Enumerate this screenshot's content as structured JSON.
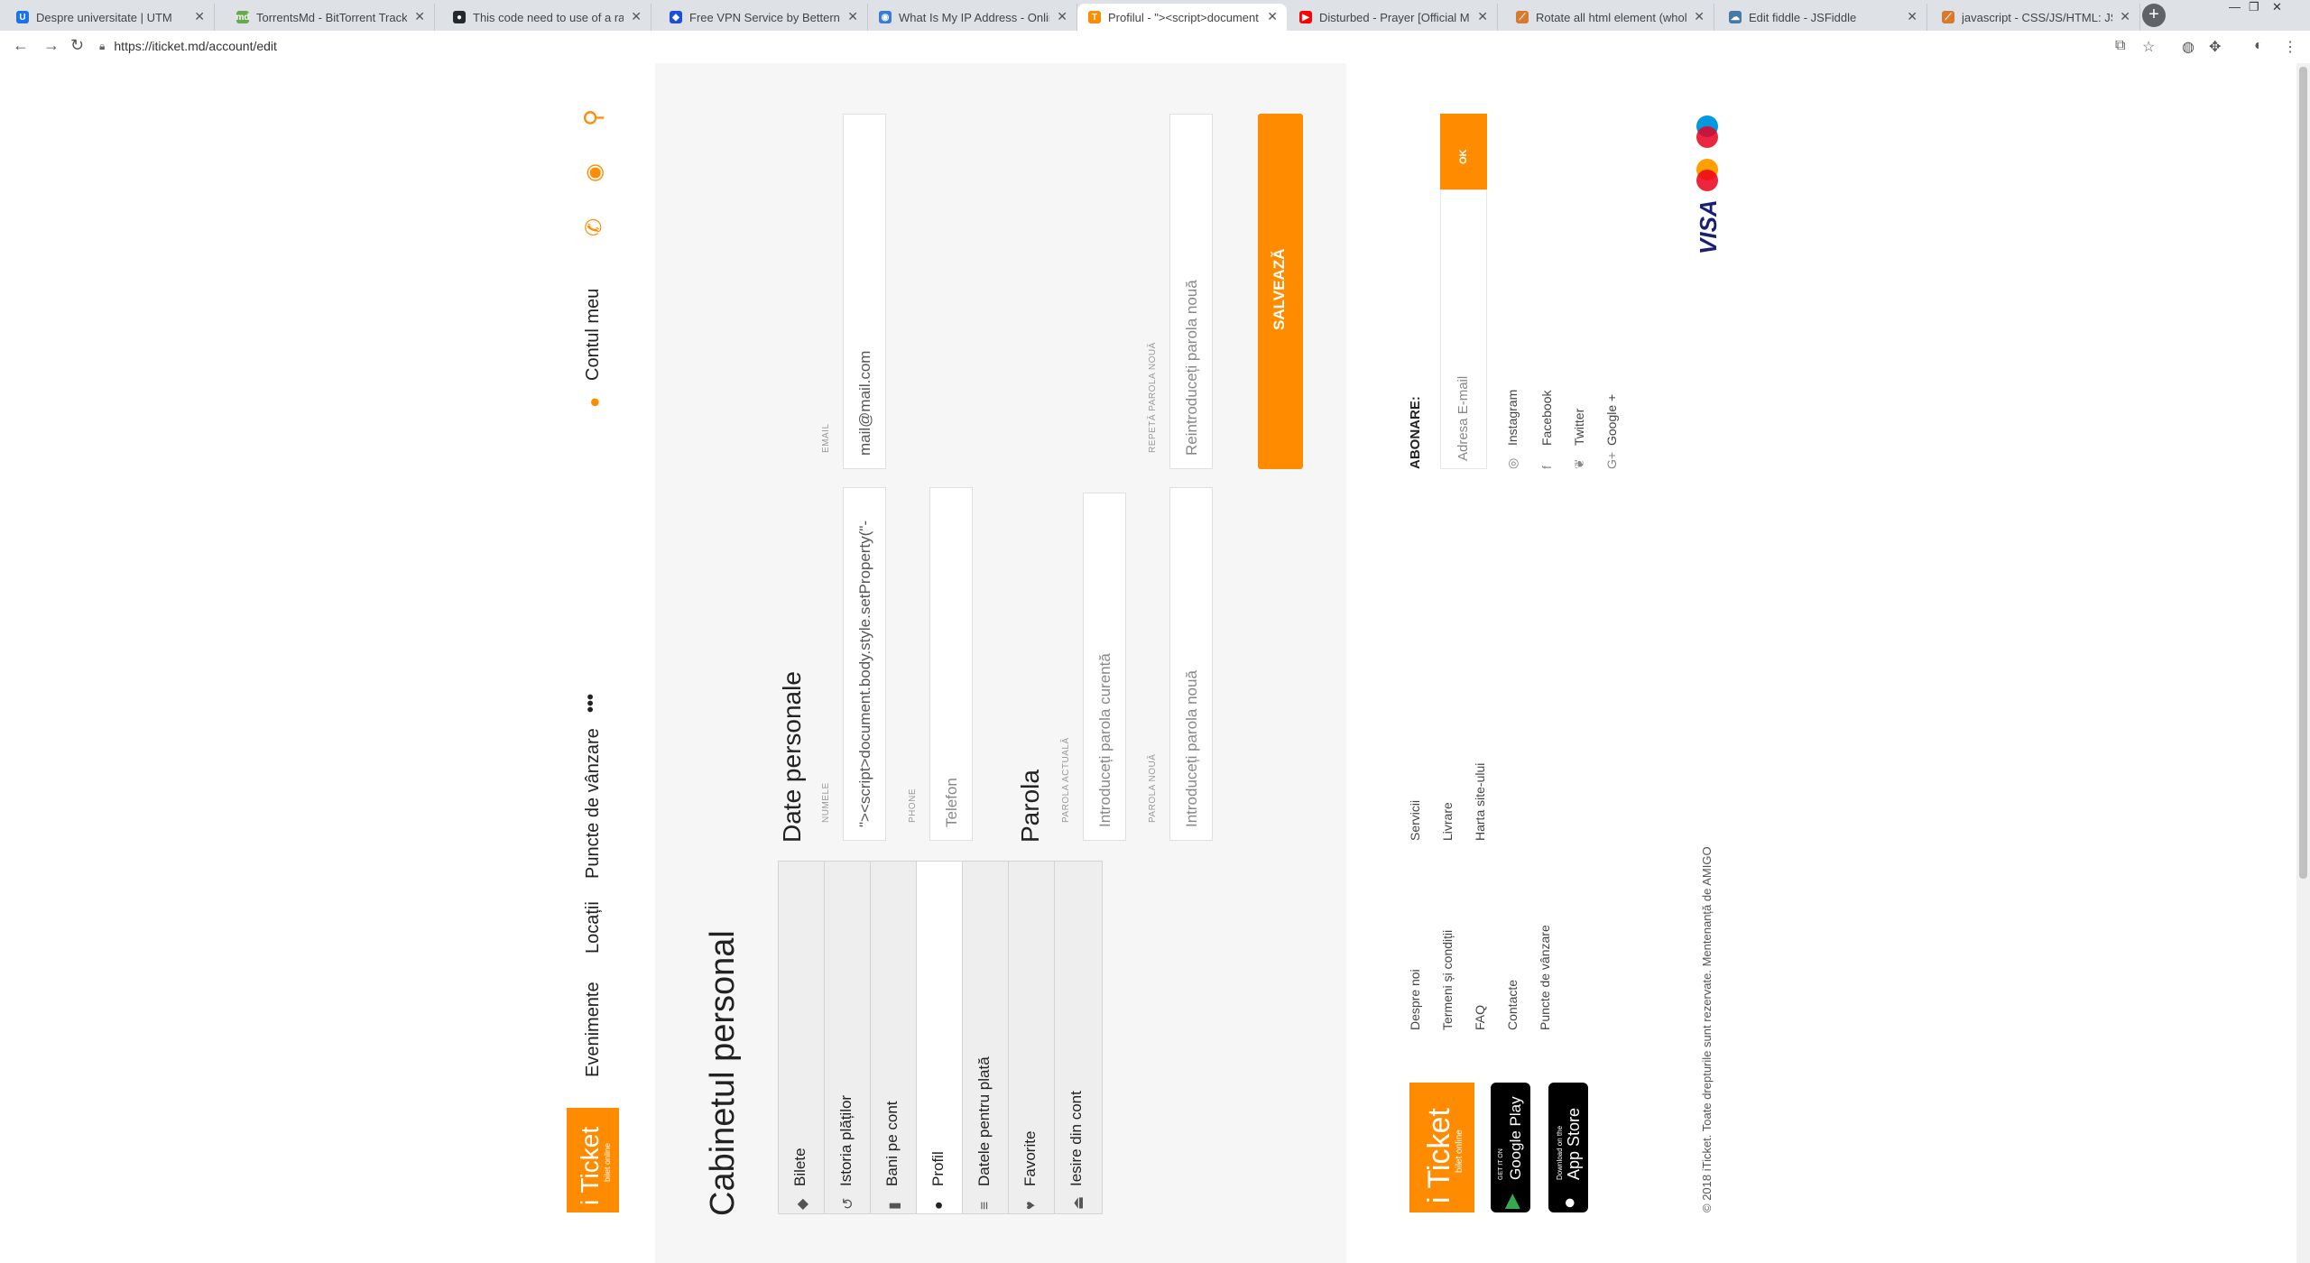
{
  "browser": {
    "tabs": [
      {
        "title": "Despre universitate | UTM",
        "fav_color": "#1a73e8",
        "fav_glyph": "U"
      },
      {
        "title": "TorrentsMd - BitTorrent Tracker",
        "fav_color": "#6aa84f",
        "fav_glyph": "md"
      },
      {
        "title": "This code need to use of a rando",
        "fav_color": "#24292e",
        "fav_glyph": "●"
      },
      {
        "title": "Free VPN Service by Betternet |",
        "fav_color": "#1e4fd8",
        "fav_glyph": "◆"
      },
      {
        "title": "What Is My IP Address - Online",
        "fav_color": "#3a7bd5",
        "fav_glyph": "◉"
      },
      {
        "title": "Profilul - \"><script>document.b",
        "fav_color": "#ff8c00",
        "fav_glyph": "T"
      },
      {
        "title": "Disturbed - Prayer [Official M",
        "fav_color": "#ff0000",
        "fav_glyph": "▶"
      },
      {
        "title": "Rotate all html element (whole p",
        "fav_color": "#d87a2c",
        "fav_glyph": "⟋"
      },
      {
        "title": "Edit fiddle - JSFiddle",
        "fav_color": "#4679a4",
        "fav_glyph": "☁"
      },
      {
        "title": "javascript - CSS/JS/HTML: JS Fun",
        "fav_color": "#d87a2c",
        "fav_glyph": "⟋"
      }
    ],
    "url": "https://iticket.md/account/edit"
  },
  "nav": {
    "logo_main": "i Ticket",
    "logo_sub": "bilet online",
    "links": [
      "Evenimente",
      "Locații",
      "Puncte de vânzare"
    ],
    "more": "•••",
    "account": "Contul meu"
  },
  "main": {
    "page_title": "Cabinetul personal",
    "menu": [
      {
        "label": "Bilete",
        "icon": "ticket-icon",
        "glyph": "◆"
      },
      {
        "label": "Istoria plăților",
        "icon": "history-icon",
        "glyph": "↺"
      },
      {
        "label": "Bani pe cont",
        "icon": "wallet-icon",
        "glyph": "▮"
      },
      {
        "label": "Profil",
        "icon": "user-icon",
        "glyph": "●"
      },
      {
        "label": "Datele pentru plată",
        "icon": "card-icon",
        "glyph": "≡"
      },
      {
        "label": "Favorite",
        "icon": "heart-icon",
        "glyph": "♥"
      },
      {
        "label": "Iesire din cont",
        "icon": "logout-icon",
        "glyph": "⏏"
      }
    ],
    "personal_title": "Date personale",
    "name_label": "NUMELE",
    "name_value": "\"><script>document.body.style.setProperty(\"-",
    "email_label": "EMAIL",
    "email_value": "mail@mail.com",
    "phone_label": "PHONE",
    "phone_placeholder": "Telefon",
    "password_title": "Parola",
    "current_pw_label": "PAROLA ACTUALĂ",
    "current_pw_placeholder": "Introduceți parola curentă",
    "new_pw_label": "PAROLA NOUĂ",
    "new_pw_placeholder": "Introduceți parola nouă",
    "repeat_pw_label": "REPETĂ PAROLA NOUĂ",
    "repeat_pw_placeholder": "Reintroduceți parola nouă",
    "save_label": "SALVEAZĂ"
  },
  "footer": {
    "logo_main": "i Ticket",
    "logo_sub": "bilet online",
    "google_play_top": "GET IT ON",
    "google_play_main": "Google Play",
    "app_store_top": "Download on the",
    "app_store_main": "App Store",
    "links_col1": [
      "Despre noi",
      "Termeni și condiții",
      "FAQ",
      "Contacte",
      "Puncte de vânzare"
    ],
    "links_col2": [
      "Servicii",
      "Livrare",
      "Harta site-ului"
    ],
    "subscribe_title": "ABONARE:",
    "subscribe_placeholder": "Adresa E-mail",
    "subscribe_button": "OK",
    "social": [
      {
        "label": "Instagram",
        "icon": "instagram-icon",
        "glyph": "◎"
      },
      {
        "label": "Facebook",
        "icon": "facebook-icon",
        "glyph": "f"
      },
      {
        "label": "Twitter",
        "icon": "twitter-icon",
        "glyph": "❦"
      },
      {
        "label": "Google +",
        "icon": "google-plus-icon",
        "glyph": "G+"
      }
    ]
  },
  "bottom": {
    "copyright": "© 2018 iTicket. Toate drepturile sunt rezervate. Mentenanță de AMIGO",
    "visa": "VISA"
  },
  "colors": {
    "accent": "#ff8c00"
  }
}
